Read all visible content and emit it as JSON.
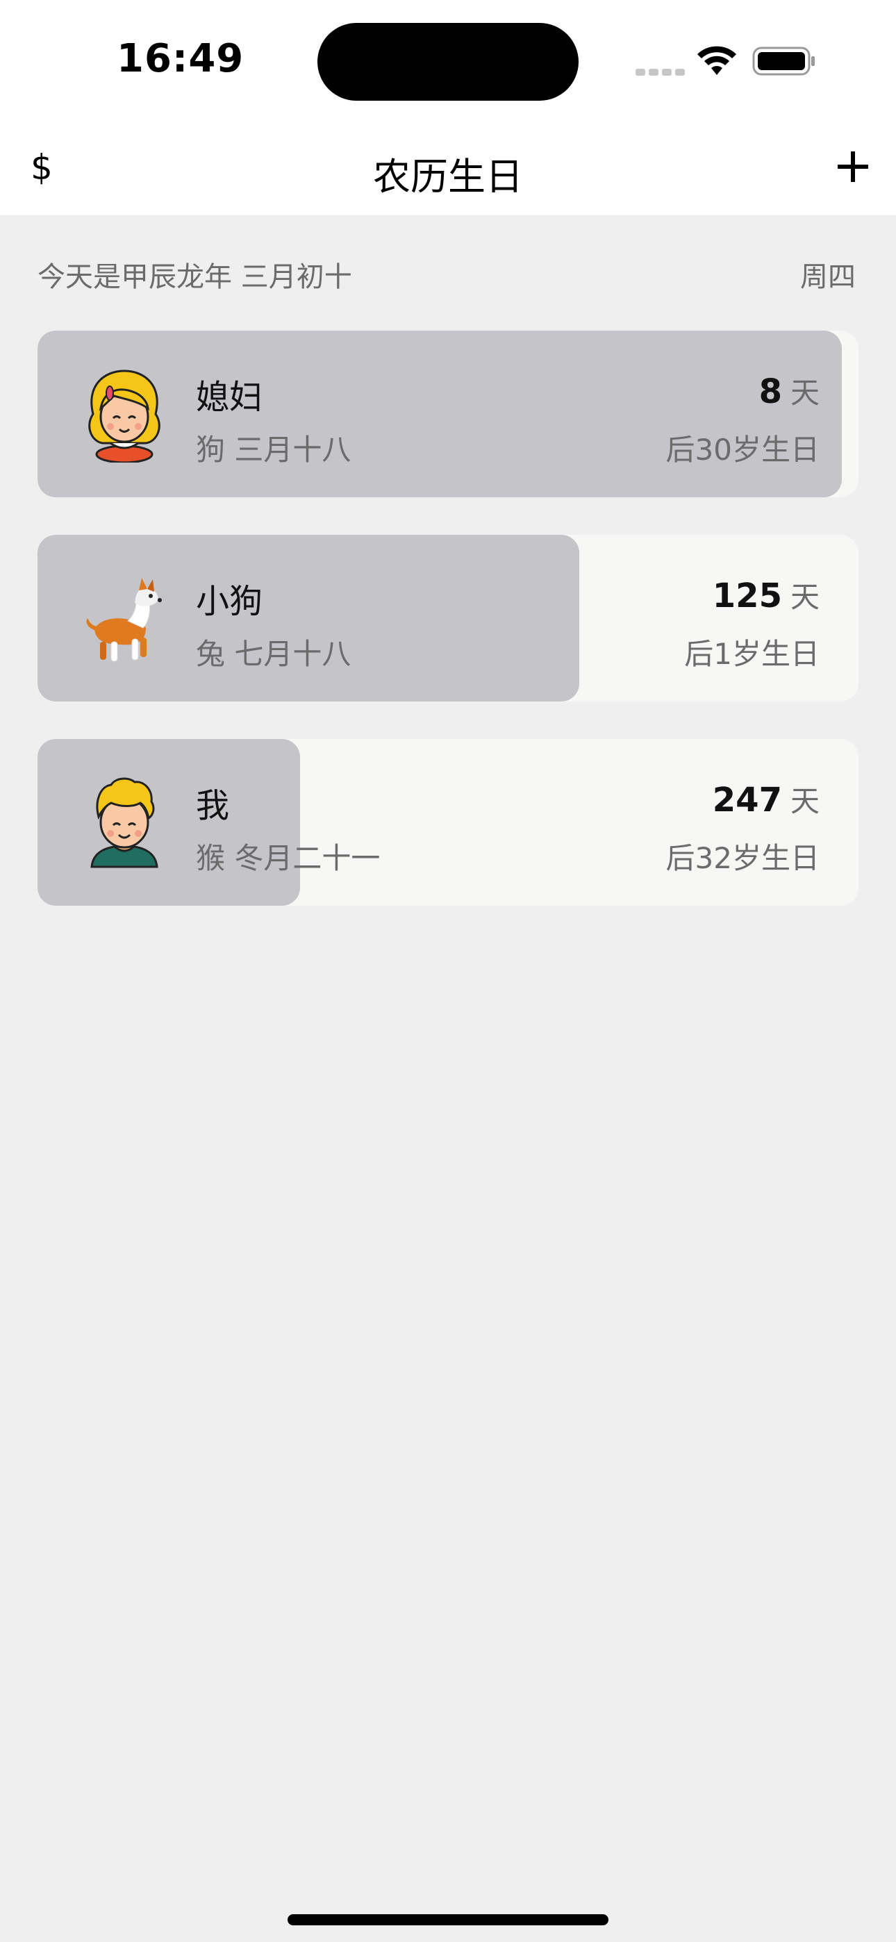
{
  "status": {
    "time": "16:49"
  },
  "nav": {
    "left_label": "$",
    "title": "农历生日"
  },
  "today": {
    "lunar_text": "今天是甲辰龙年 三月初十",
    "weekday": "周四"
  },
  "birthdays": [
    {
      "name": "媳妇",
      "lunar_date": "狗 三月十八",
      "days": "8",
      "days_unit": "天",
      "age_text": "后30岁生日",
      "avatar": "girl-avatar-icon",
      "progress": 0.98
    },
    {
      "name": "小狗",
      "lunar_date": "兔 七月十八",
      "days": "125",
      "days_unit": "天",
      "age_text": "后1岁生日",
      "avatar": "dog-avatar-icon",
      "progress": 0.66
    },
    {
      "name": "我",
      "lunar_date": "猴 冬月二十一",
      "days": "247",
      "days_unit": "天",
      "age_text": "后32岁生日",
      "avatar": "boy-avatar-icon",
      "progress": 0.32
    }
  ],
  "colors": {
    "background": "#efefef",
    "card": "#f7f7f5",
    "progress": "#c4c4c9",
    "secondary_text": "#6b6b6b"
  }
}
